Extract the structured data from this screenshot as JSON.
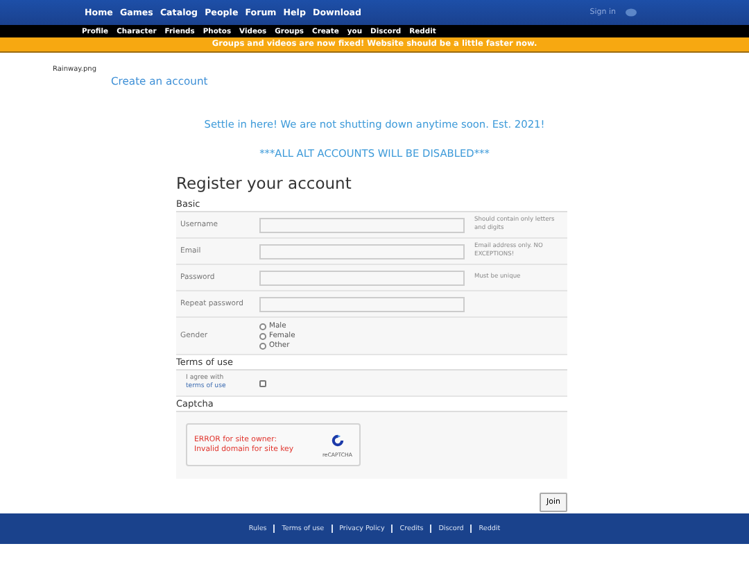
{
  "nav": {
    "links": [
      "Home",
      "Games",
      "Catalog",
      "People",
      "Forum",
      "Help",
      "Download"
    ],
    "sign_in": "Sign in"
  },
  "subnav": {
    "links": [
      "Profile",
      "Character",
      "Friends",
      "Photos",
      "Videos",
      "Groups",
      "Create",
      "you",
      "Discord",
      "Reddit"
    ]
  },
  "banner": "Groups and videos are now fixed! Website should be a little faster now.",
  "logo_alt": "Rainway.png",
  "create_link": "Create an account",
  "notices": [
    "Settle in here! We are not shutting down anytime soon. Est. 2021!",
    "***ALL ALT ACCOUNTS WILL BE DISABLED***"
  ],
  "form": {
    "title": "Register your account",
    "basic": {
      "heading": "Basic",
      "fields": [
        {
          "label": "Username",
          "hint": "Should contain only letters and digits"
        },
        {
          "label": "Email",
          "hint": "Email address only. NO EXCEPTIONS!"
        },
        {
          "label": "Password",
          "hint": "Must be unique"
        },
        {
          "label": "Repeat password"
        }
      ],
      "gender": {
        "label": "Gender",
        "options": [
          {
            "label": "Male",
            "selected": false
          },
          {
            "label": "Female",
            "selected": false
          },
          {
            "label": "Other",
            "selected": false
          }
        ]
      }
    },
    "terms": {
      "heading": "Terms of use",
      "text": "I agree with",
      "link": "terms of use",
      "checked": false
    },
    "captcha": {
      "heading": "Captcha",
      "error": "ERROR for site owner:\nInvalid domain for site key",
      "brand": "reCAPTCHA"
    },
    "submit": "Join"
  },
  "footer": {
    "links": [
      "Rules",
      "Terms of use",
      "Privacy Policy",
      "Credits",
      "Discord",
      "Reddit"
    ]
  }
}
